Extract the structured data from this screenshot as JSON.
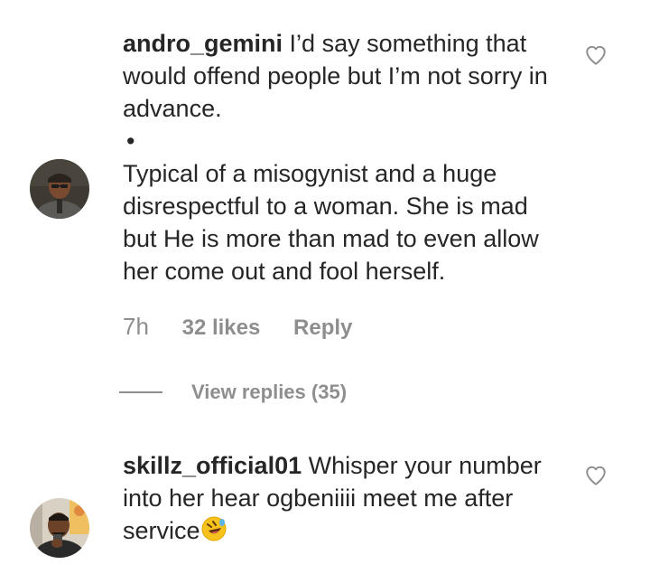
{
  "comments": [
    {
      "username": "andro_gemini",
      "text": "I’d say something that would offend people but I’m not sorry in advance.",
      "bullet": "•",
      "text2": "Typical of a misogynist and a huge disrespectful to a woman. She is mad but He is more than mad to even allow her come out and fool herself.",
      "time": "7h",
      "likes": "32 likes",
      "reply_label": "Reply",
      "view_replies": "View replies (35)"
    },
    {
      "username": "skillz_official01",
      "text": "Whisper your number into her hear ogbeniiii meet me after service",
      "emoji": "rolling-on-floor-laughing-emoji"
    }
  ],
  "colors": {
    "text": "#262626",
    "secondary": "#8e8e8e",
    "background": "#ffffff"
  }
}
